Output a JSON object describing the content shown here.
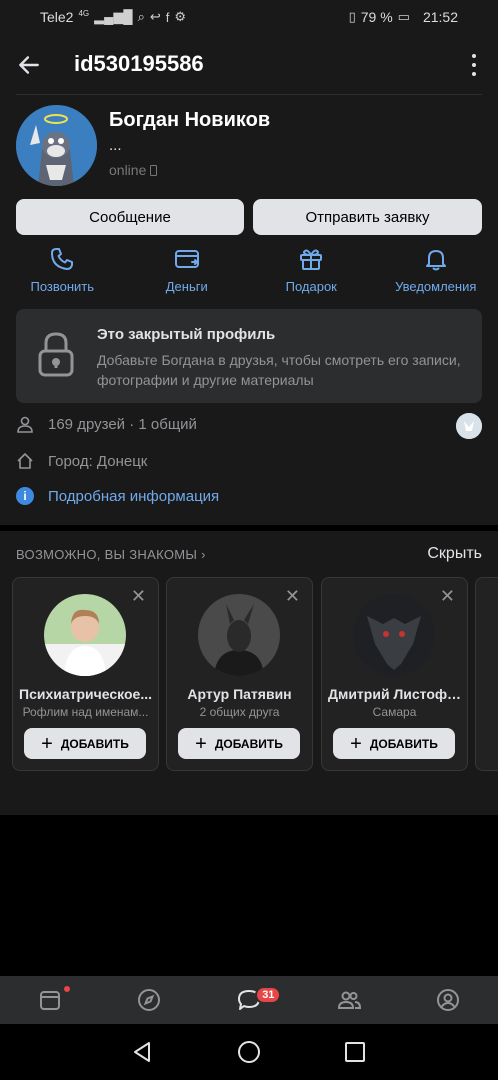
{
  "status_bar": {
    "carrier": "Tele2",
    "network": "4G",
    "battery": "79 %",
    "time": "21:52"
  },
  "header": {
    "title": "id530195586"
  },
  "profile": {
    "name": "Богдан Новиков",
    "status": "...",
    "online": "online"
  },
  "buttons": {
    "message": "Сообщение",
    "request": "Отправить заявку"
  },
  "actions": [
    {
      "label": "Позвонить",
      "icon": "phone-icon"
    },
    {
      "label": "Деньги",
      "icon": "money-icon"
    },
    {
      "label": "Подарок",
      "icon": "gift-icon"
    },
    {
      "label": "Уведомления",
      "icon": "bell-icon"
    }
  ],
  "closed_profile": {
    "title": "Это закрытый профиль",
    "description": "Добавьте Богдана в друзья, чтобы смотреть его записи, фотографии и другие материалы"
  },
  "info": {
    "friends": "169 друзей · 1 общий",
    "city": "Город: Донецк",
    "more": "Подробная информация"
  },
  "suggestions": {
    "heading": "ВОЗМОЖНО, ВЫ ЗНАКОМЫ",
    "hide": "Скрыть",
    "add_label": "ДОБАВИТЬ",
    "cards": [
      {
        "name": "Психиатрическое...",
        "sub": "Рофлим над именам..."
      },
      {
        "name": "Артур Патявин",
        "sub": "2 общих друга"
      },
      {
        "name": "Дмитрий Листофо...",
        "sub": "Самара"
      }
    ]
  },
  "tabbar": {
    "messages_badge": "31"
  },
  "colors": {
    "accent": "#71aaeb",
    "background": "#19191a",
    "card": "#2c2d2e",
    "badge": "#e64646"
  }
}
